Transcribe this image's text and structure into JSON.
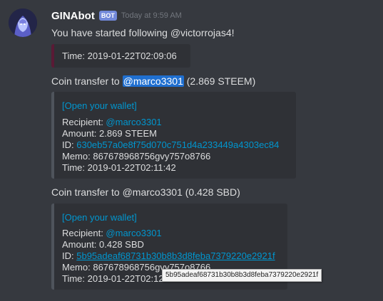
{
  "message": {
    "username": "GINAbot",
    "bot_badge": "BOT",
    "timestamp": "Today at 9:59 AM",
    "follow_text": "You have started following @victorrojas4!"
  },
  "embed1": {
    "time": "Time: 2019-01-22T02:09:06"
  },
  "transfer1": {
    "prefix": "Coin transfer to ",
    "mention": "@marco3301",
    "suffix": " (2.869 STEEM)",
    "wallet_link": "[Open your wallet]",
    "recipient_label": "Recipient: ",
    "recipient": "@marco3301",
    "amount": "Amount: 2.869 STEEM",
    "id_label": "ID: ",
    "id": "630eb57a0e8f75d070c751d4a233449a4303ec84",
    "memo": "Memo: 867678968756gvy757o8766",
    "time": "Time: 2019-01-22T02:11:42"
  },
  "transfer2": {
    "title": "Coin transfer to @marco3301 (0.428 SBD)",
    "wallet_link": "[Open your wallet]",
    "recipient_label": "Recipient: ",
    "recipient": "@marco3301",
    "amount": "Amount: 0.428 SBD",
    "id_label": "ID: ",
    "id": "5b95adeaf68731b30b8b3d8feba7379220e2921f",
    "memo": "Memo: 867678968756gvy757o8766",
    "time": "Time: 2019-01-22T02:12:27"
  },
  "tooltip": {
    "text": "5b95adeaf68731b30b8b3d8feba7379220e2921f"
  },
  "colors": {
    "background": "#36393f",
    "embed_bg": "#2f3136",
    "link": "#0096cf",
    "mention_highlight": "#1f6fd0",
    "bot_badge": "#7289da"
  }
}
